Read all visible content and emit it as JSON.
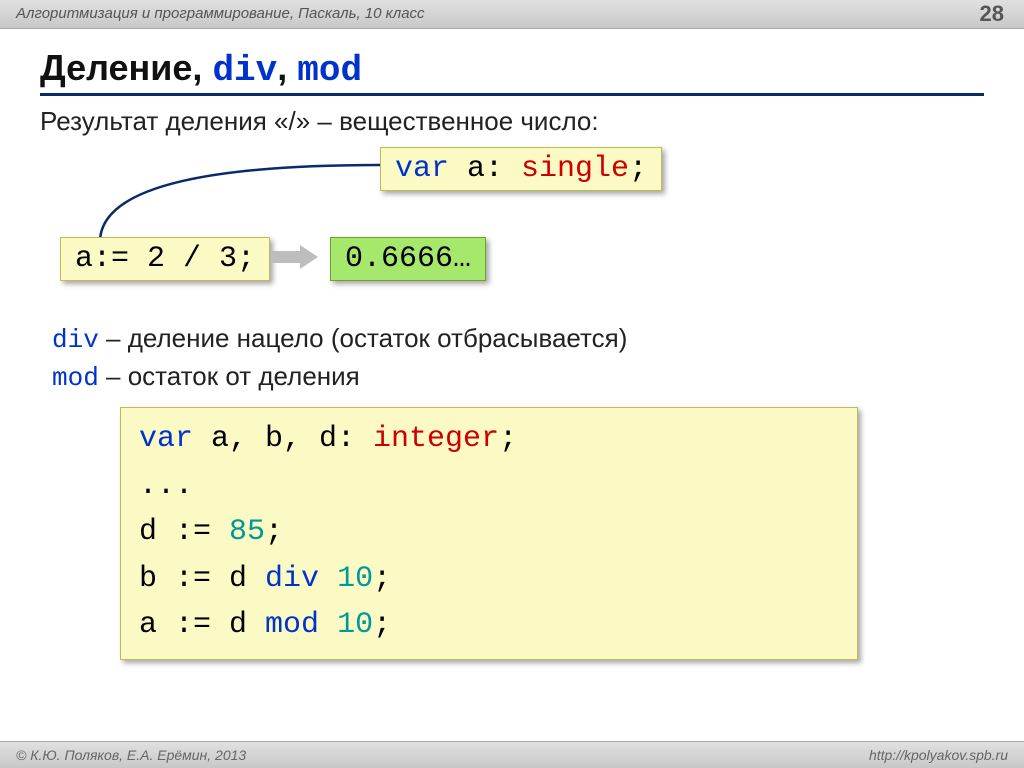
{
  "header": {
    "course": "Алгоритмизация и программирование, Паскаль, 10 класс",
    "page": "28"
  },
  "title": {
    "text": "Деление, ",
    "kw1": "div",
    "sep": ", ",
    "kw2": "mod"
  },
  "lead": "Результат деления «/» – вещественное число:",
  "box_var": {
    "kw": "var",
    "rest": " a: ",
    "type": "single",
    "semi": ";"
  },
  "box_expr": "a:= 2 / 3;",
  "result": "0.6666…",
  "defs": {
    "div_kw": "div",
    "div_text": " – деление нацело (остаток отбрасывается)",
    "mod_kw": "mod",
    "mod_text": " – остаток от деления"
  },
  "bigcode": {
    "l1_kw": "var",
    "l1_mid": " a, b, d: ",
    "l1_type": "integer",
    "l1_end": ";",
    "l2": "...",
    "l3_a": "d := ",
    "l3_num": "85",
    "l3_b": ";",
    "l4_a": "b := d ",
    "l4_kw": "div",
    "l4_sp": " ",
    "l4_num": "10",
    "l4_b": ";",
    "l5_a": "a := d ",
    "l5_kw": "mod",
    "l5_sp": " ",
    "l5_num": "10",
    "l5_b": ";"
  },
  "footer": {
    "left": "© К.Ю. Поляков, Е.А. Ерёмин, 2013",
    "right": "http://kpolyakov.spb.ru"
  }
}
